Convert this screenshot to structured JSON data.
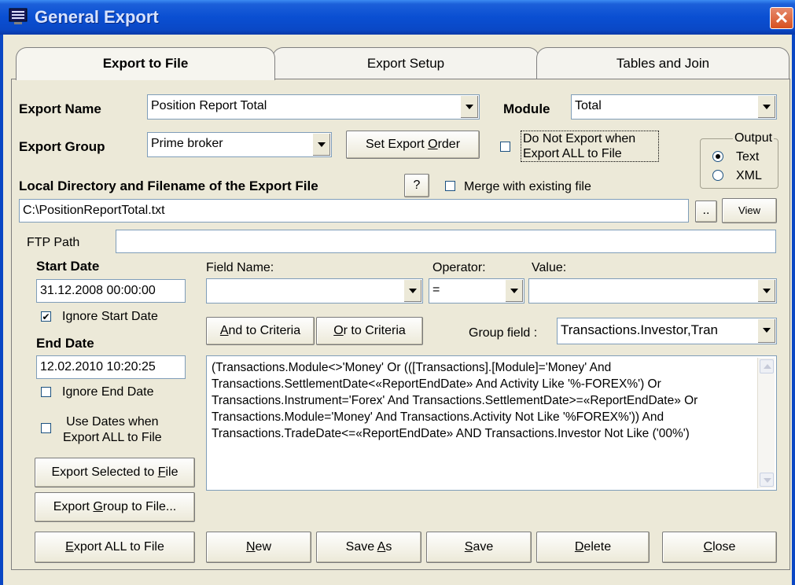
{
  "window": {
    "title": "General Export",
    "close_label": "✕"
  },
  "tabs": [
    "Export to File",
    "Export Setup",
    "Tables and Join"
  ],
  "export_name": {
    "label": "Export Name",
    "value": "Position Report Total"
  },
  "module": {
    "label": "Module",
    "value": "Total"
  },
  "export_group": {
    "label": "Export Group",
    "value": "Prime broker"
  },
  "set_export_order": {
    "pre": "Set Export ",
    "key": "O",
    "post": "rder"
  },
  "do_not_export": {
    "line1": "Do Not Export when",
    "line2": "Export ALL to File",
    "checked": false
  },
  "output": {
    "label": "Output",
    "options": [
      "Text",
      "XML"
    ],
    "selected": "Text"
  },
  "local_dir": {
    "label": "Local Directory and Filename of the Export File",
    "help": "?",
    "merge_label": "Merge with existing file",
    "value": "C:\\PositionReportTotal.txt",
    "browse": "..",
    "view": "View"
  },
  "ftp": {
    "label": "FTP Path",
    "value": ""
  },
  "start_date": {
    "label": "Start Date",
    "value": "31.12.2008 00:00:00",
    "ignore_label": "Ignore Start Date",
    "ignore_checked": true
  },
  "end_date": {
    "label": "End Date",
    "value": "12.02.2010 10:20:25",
    "ignore_label": "Ignore End Date",
    "ignore_checked": false
  },
  "use_dates": {
    "line1": "Use Dates when",
    "line2": "Export ALL to File",
    "checked": false
  },
  "criteria": {
    "field_label": "Field Name:",
    "field_value": "",
    "operator_label": "Operator:",
    "operator_value": "=",
    "value_label": "Value:",
    "value_value": "",
    "and_btn": {
      "key": "A",
      "rest": "nd to Criteria"
    },
    "or_btn": {
      "key": "O",
      "rest": "r to Criteria"
    },
    "group_field_label": "Group field :",
    "group_field_value": "Transactions.Investor,Tran",
    "text": "(Transactions.Module<>'Money' Or (([Transactions].[Module]='Money' And Transactions.SettlementDate<«ReportEndDate» And Activity Like '%-FOREX%') Or Transactions.Instrument='Forex' And Transactions.SettlementDate>=«ReportEndDate» Or Transactions.Module='Money' And Transactions.Activity Not Like '%FOREX%')) And Transactions.TradeDate<=«ReportEndDate» AND Transactions.Investor Not Like ('00%')"
  },
  "buttons": {
    "export_selected": {
      "pre": "Export Selected to ",
      "key": "F",
      "post": "ile"
    },
    "export_group": {
      "pre": "Export ",
      "key": "G",
      "post": "roup to File..."
    },
    "export_all": {
      "pre": "",
      "key": "E",
      "post": "xport ALL to File"
    },
    "new": {
      "pre": "",
      "key": "N",
      "post": "ew"
    },
    "save_as": {
      "pre": "Save ",
      "key": "A",
      "post": "s"
    },
    "save": {
      "pre": "",
      "key": "S",
      "post": "ave"
    },
    "delete": {
      "pre": "",
      "key": "D",
      "post": "elete"
    },
    "close": {
      "pre": "",
      "key": "C",
      "post": "lose"
    }
  }
}
